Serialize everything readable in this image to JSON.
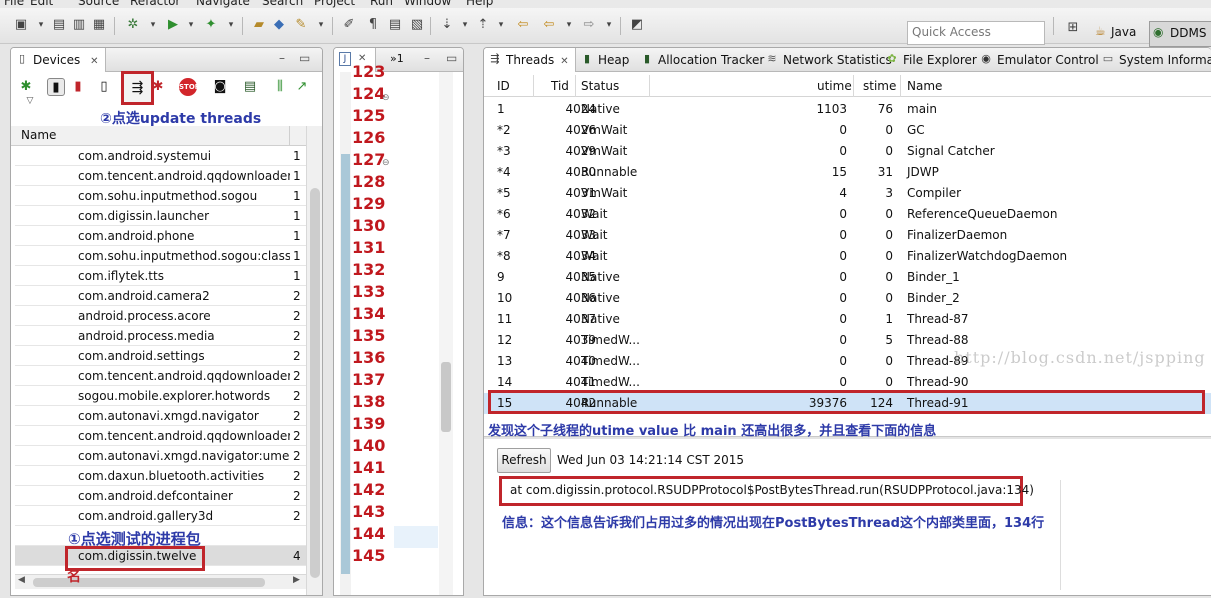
{
  "menu": [
    "File",
    "Edit",
    "Source",
    "Refactor",
    "Navigate",
    "Search",
    "Project",
    "Run",
    "Window",
    "Help"
  ],
  "toolbar": {
    "quick_access_placeholder": "Quick Access",
    "perspective_java": "Java",
    "perspective_ddms": "DDMS"
  },
  "devices": {
    "tab_label": "Devices",
    "column_name": "Name",
    "processes": [
      {
        "name": "com.android.systemui",
        "pid": "1"
      },
      {
        "name": "com.tencent.android.qqdownloader",
        "pid": "1"
      },
      {
        "name": "com.sohu.inputmethod.sogou",
        "pid": "1"
      },
      {
        "name": "com.digissin.launcher",
        "pid": "1"
      },
      {
        "name": "com.android.phone",
        "pid": "1"
      },
      {
        "name": "com.sohu.inputmethod.sogou:classic",
        "pid": "1"
      },
      {
        "name": "com.iflytek.tts",
        "pid": "1"
      },
      {
        "name": "com.android.camera2",
        "pid": "2"
      },
      {
        "name": "android.process.acore",
        "pid": "2"
      },
      {
        "name": "android.process.media",
        "pid": "2"
      },
      {
        "name": "com.android.settings",
        "pid": "2"
      },
      {
        "name": "com.tencent.android.qqdownloader",
        "pid": "2"
      },
      {
        "name": "sogou.mobile.explorer.hotwords",
        "pid": "2"
      },
      {
        "name": "com.autonavi.xmgd.navigator",
        "pid": "2"
      },
      {
        "name": "com.tencent.android.qqdownloader",
        "pid": "2"
      },
      {
        "name": "com.autonavi.xmgd.navigator:umeng",
        "pid": "2"
      },
      {
        "name": "com.daxun.bluetooth.activities",
        "pid": "2"
      },
      {
        "name": "com.android.defcontainer",
        "pid": "2"
      },
      {
        "name": "com.android.gallery3d",
        "pid": "2"
      },
      {
        "name": "",
        "pid": ""
      },
      {
        "name": "com.digissin.twelve",
        "pid": "4"
      }
    ]
  },
  "editor": {
    "tab_overflow": "»1",
    "line_numbers": [
      "123",
      "124",
      "125",
      "126",
      "127",
      "128",
      "129",
      "130",
      "131",
      "132",
      "133",
      "134",
      "135",
      "136",
      "137",
      "138",
      "139",
      "140",
      "141",
      "142",
      "143",
      "144",
      "145"
    ]
  },
  "tabs": [
    {
      "label": "Threads",
      "icon": "threads-icon"
    },
    {
      "label": "Heap",
      "icon": "heap-icon"
    },
    {
      "label": "Allocation Tracker",
      "icon": "allocation-icon"
    },
    {
      "label": "Network Statistics",
      "icon": "network-icon"
    },
    {
      "label": "File Explorer",
      "icon": "android-icon"
    },
    {
      "label": "Emulator Control",
      "icon": "emulator-icon"
    },
    {
      "label": "System Informat",
      "icon": "sysinfo-icon"
    }
  ],
  "threads": {
    "columns": [
      "ID",
      "Tid",
      "Status",
      "utime",
      "stime",
      "Name"
    ],
    "rows": [
      {
        "id": "1",
        "tid": "4024",
        "status": "Native",
        "utime": "1103",
        "stime": "76",
        "name": "main"
      },
      {
        "id": "*2",
        "tid": "4026",
        "status": "VmWait",
        "utime": "0",
        "stime": "0",
        "name": "GC"
      },
      {
        "id": "*3",
        "tid": "4029",
        "status": "VmWait",
        "utime": "0",
        "stime": "0",
        "name": "Signal Catcher"
      },
      {
        "id": "*4",
        "tid": "4030",
        "status": "Runnable",
        "utime": "15",
        "stime": "31",
        "name": "JDWP"
      },
      {
        "id": "*5",
        "tid": "4031",
        "status": "VmWait",
        "utime": "4",
        "stime": "3",
        "name": "Compiler"
      },
      {
        "id": "*6",
        "tid": "4032",
        "status": "Wait",
        "utime": "0",
        "stime": "0",
        "name": "ReferenceQueueDaemon"
      },
      {
        "id": "*7",
        "tid": "4033",
        "status": "Wait",
        "utime": "0",
        "stime": "0",
        "name": "FinalizerDaemon"
      },
      {
        "id": "*8",
        "tid": "4034",
        "status": "Wait",
        "utime": "0",
        "stime": "0",
        "name": "FinalizerWatchdogDaemon"
      },
      {
        "id": "9",
        "tid": "4035",
        "status": "Native",
        "utime": "0",
        "stime": "0",
        "name": "Binder_1"
      },
      {
        "id": "10",
        "tid": "4036",
        "status": "Native",
        "utime": "0",
        "stime": "0",
        "name": "Binder_2"
      },
      {
        "id": "11",
        "tid": "4037",
        "status": "Native",
        "utime": "0",
        "stime": "1",
        "name": "Thread-87"
      },
      {
        "id": "12",
        "tid": "4039",
        "status": "TimedW...",
        "utime": "0",
        "stime": "5",
        "name": "Thread-88"
      },
      {
        "id": "13",
        "tid": "4040",
        "status": "TimedW...",
        "utime": "0",
        "stime": "0",
        "name": "Thread-89"
      },
      {
        "id": "14",
        "tid": "4041",
        "status": "TimedW...",
        "utime": "0",
        "stime": "0",
        "name": "Thread-90"
      },
      {
        "id": "15",
        "tid": "4042",
        "status": "Runnable",
        "utime": "39376",
        "stime": "124",
        "name": "Thread-91"
      }
    ],
    "refresh_label": "Refresh",
    "refresh_time": "Wed Jun 03 14:21:14 CST 2015",
    "stack_trace": "at com.digissin.protocol.RSUDPProtocol$PostBytesThread.run(RSUDPProtocol.java:134)"
  },
  "watermark": "http://blog.csdn.net/jspping",
  "annotations": {
    "update_threads": "②点选update threads",
    "select_process": "①点选测试的进程包",
    "found_thread": "发现这个子线程的utime value 比 main 还高出很多，并且查看下面的信息",
    "info_note": "信息：这个信息告诉我们占用过多的情况出现在PostBytesThread这个内部类里面，134行",
    "tail_char": "名"
  },
  "colors": {
    "annotation_box": "#c0252b",
    "annotation_text": "#2d3aa8",
    "line_numbers": "#c0181e",
    "selected_row": "#cfe3f7"
  }
}
